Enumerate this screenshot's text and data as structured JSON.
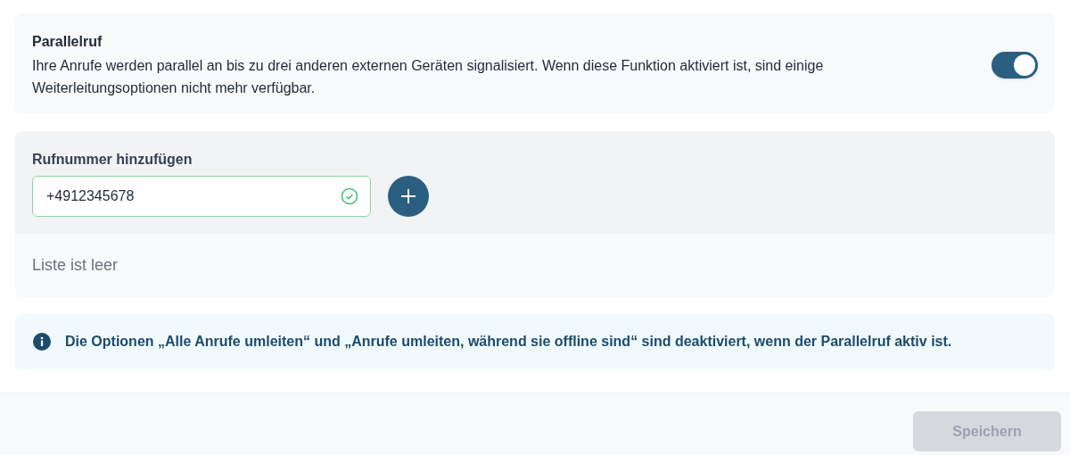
{
  "parallel_call": {
    "title": "Parallelruf",
    "description": "Ihre Anrufe werden parallel an bis zu drei anderen externen Geräten signalisiert. Wenn diese Funktion aktiviert ist, sind einige Weiterleitungsoptionen nicht mehr verfügbar.",
    "on": true
  },
  "add_number": {
    "label": "Rufnummer hinzufügen",
    "value": "+4912345678",
    "valid": true
  },
  "list": {
    "empty_text": "Liste ist leer"
  },
  "info": "Die Optionen „Alle Anrufe umleiten“ und „Anrufe umleiten, während sie offline sind“ sind deaktiviert, wenn der Parallelruf aktiv ist.",
  "save_button": {
    "label": "Speichern",
    "disabled": true
  }
}
